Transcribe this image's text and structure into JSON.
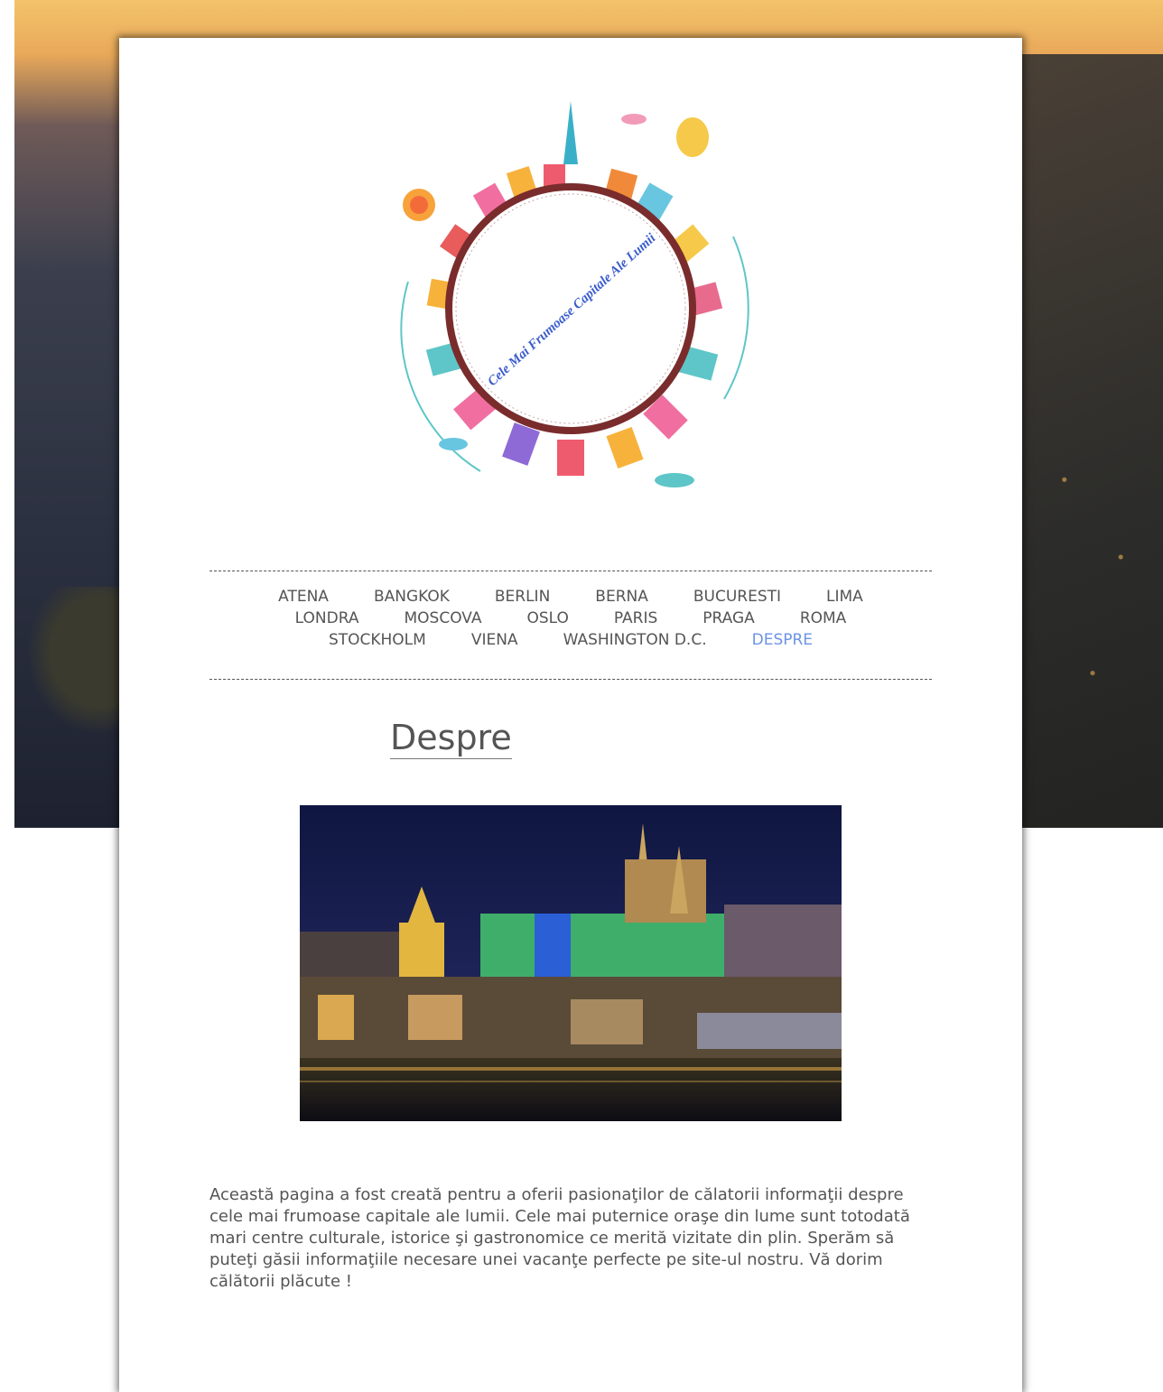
{
  "logo": {
    "text": "Cele Mai Frumoase Capitale Ale Lumii"
  },
  "nav": {
    "rows": [
      [
        "ATENA",
        "BANGKOK",
        "BERLIN",
        "BERNA",
        "BUCURESTI",
        "LIMA"
      ],
      [
        "LONDRA",
        "MOSCOVA",
        "OSLO",
        "PARIS",
        "PRAGA",
        "ROMA"
      ],
      [
        "STOCKHOLM",
        "VIENA",
        "WASHINGTON D.C.",
        "DESPRE"
      ]
    ],
    "active": "DESPRE"
  },
  "page": {
    "title": "Despre",
    "text": "Această pagina a fost creată pentru a oferii pasionaţilor de călatorii informaţii despre cele mai frumoase capitale ale lumii. Cele mai puternice oraşe din lume sunt totodată mari centre culturale, istorice şi gastronomice ce merită vizitate din plin. Sperăm să puteţi găsii informaţiile necesare unei vacanţe perfecte pe site-ul nostru. Vă dorim călătorii plăcute !"
  },
  "colors": {
    "active_link": "#6c93e6",
    "text": "#555555",
    "ring": "#7a2c2c"
  }
}
